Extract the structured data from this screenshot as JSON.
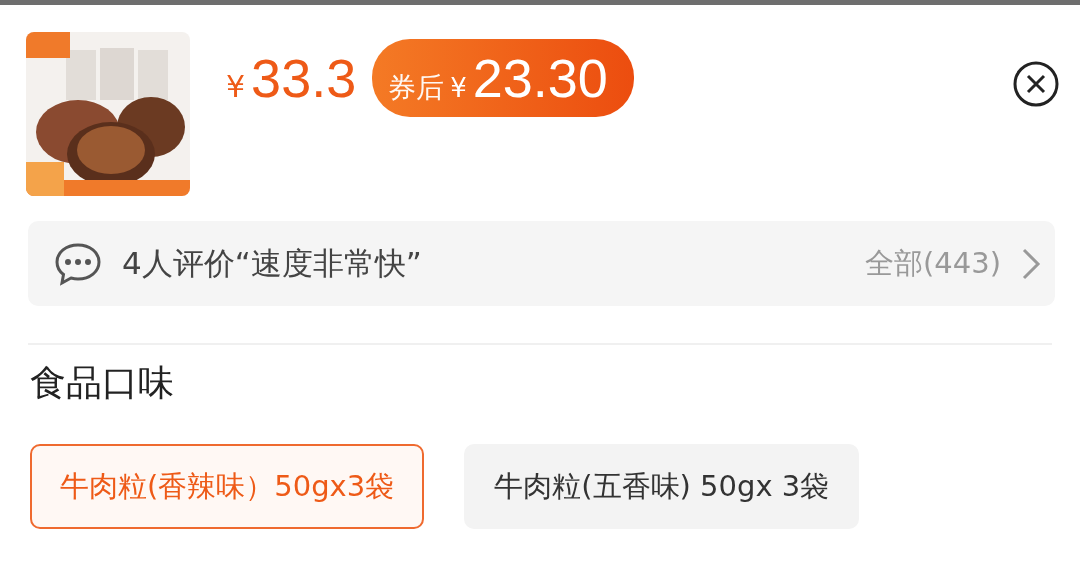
{
  "product": {
    "price_symbol": "¥",
    "price": "33.3",
    "coupon": {
      "label": "券后",
      "symbol": "¥",
      "price": "23.30"
    }
  },
  "review": {
    "text": "4人评价“速度非常快”",
    "all": "全部(443)"
  },
  "spec": {
    "title": "食品口味",
    "options": [
      {
        "label": "牛肉粒(香辣味）50gx3袋",
        "selected": true
      },
      {
        "label": "牛肉粒(五香味) 50gx 3袋",
        "selected": false
      }
    ]
  }
}
